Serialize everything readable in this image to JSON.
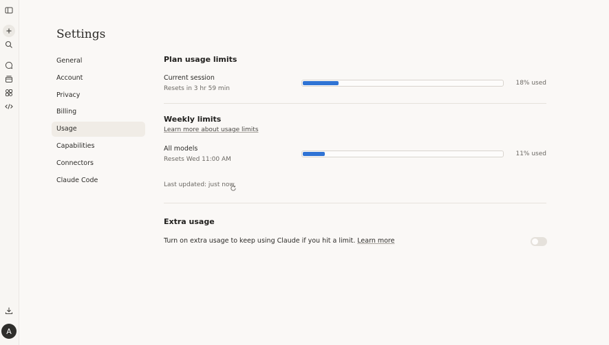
{
  "page_title": "Settings",
  "nav": [
    {
      "label": "General"
    },
    {
      "label": "Account"
    },
    {
      "label": "Privacy"
    },
    {
      "label": "Billing"
    },
    {
      "label": "Usage",
      "active": true
    },
    {
      "label": "Capabilities"
    },
    {
      "label": "Connectors"
    },
    {
      "label": "Claude Code"
    }
  ],
  "rail": {
    "icons": [
      "sidebar-toggle-icon",
      "new-chat-icon",
      "search-icon",
      "chats-icon",
      "projects-icon",
      "artifacts-icon",
      "code-icon",
      "download-icon"
    ],
    "avatar_letter": "A"
  },
  "plan": {
    "title": "Plan usage limits",
    "session_title": "Current session",
    "session_reset": "Resets in 3 hr 59 min",
    "session_used": "18% used",
    "session_fraction": 0.18
  },
  "weekly": {
    "title": "Weekly limits",
    "learn_more": "Learn more about usage limits",
    "models_title": "All models",
    "models_reset": "Resets Wed 11:00 AM",
    "models_used": "11% used",
    "models_fraction": 0.11,
    "last_updated": "Last updated: just now"
  },
  "extra": {
    "title": "Extra usage",
    "description": "Turn on extra usage to keep using Claude if you hit a limit.",
    "learn_more": "Learn more",
    "enabled": false
  },
  "colors": {
    "accent": "#2f73d4",
    "background": "#faf8f6"
  }
}
